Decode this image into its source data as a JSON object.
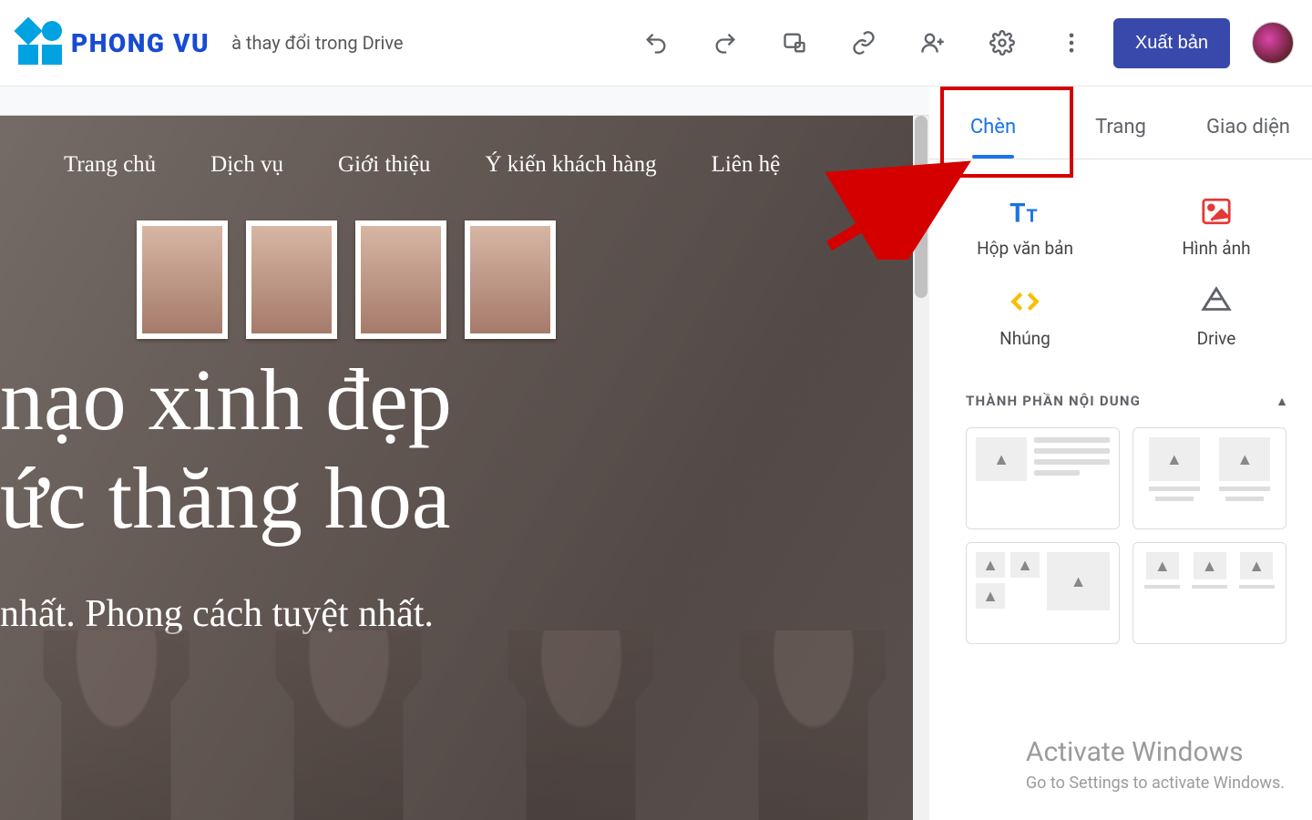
{
  "header": {
    "logo_text": "PHONG VU",
    "save_hint": "à thay đổi trong Drive",
    "publish": "Xuất bản"
  },
  "site_nav": [
    "Trang chủ",
    "Dịch vụ",
    "Giới thiệu",
    "Ý kiến khách hàng",
    "Liên hệ"
  ],
  "hero": {
    "line1": "nạo xinh đẹp",
    "line2": "ức thăng hoa",
    "sub": "nhất. Phong cách tuyệt nhất."
  },
  "sidebar": {
    "tabs": {
      "insert": "Chèn",
      "pages": "Trang",
      "themes": "Giao diện"
    },
    "tools": {
      "textbox": "Hộp văn bản",
      "image": "Hình ảnh",
      "embed": "Nhúng",
      "drive": "Drive"
    },
    "section_label": "THÀNH PHẦN NỘI DUNG"
  },
  "watermark": {
    "title": "Activate Windows",
    "sub": "Go to Settings to activate Windows."
  }
}
